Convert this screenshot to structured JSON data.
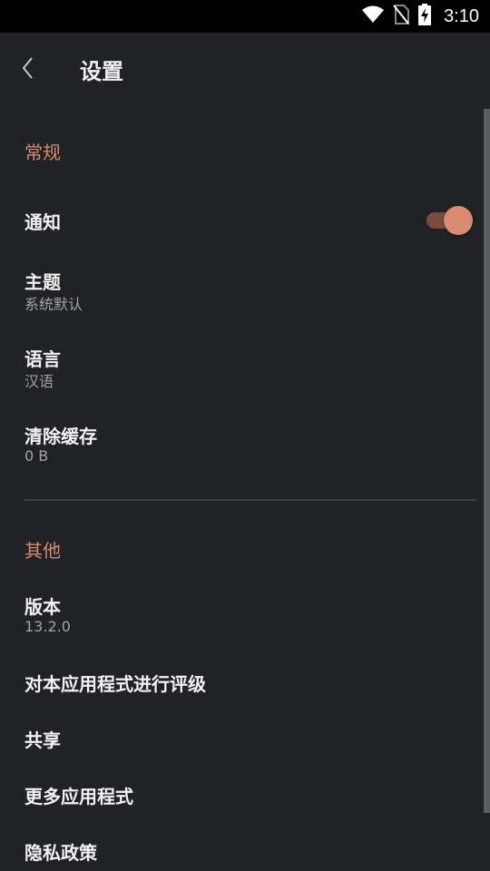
{
  "status_bar": {
    "time": "3:10",
    "icons": [
      "wifi-icon",
      "no-sim-icon",
      "battery-charging-icon"
    ]
  },
  "toolbar": {
    "back_icon": "chevron-left-icon",
    "title": "设置"
  },
  "sections": {
    "general": {
      "header": "常规",
      "notifications": {
        "title": "通知",
        "enabled": true
      },
      "theme": {
        "title": "主题",
        "value": "系统默认"
      },
      "language": {
        "title": "语言",
        "value": "汉语"
      },
      "clear_cache": {
        "title": "清除缓存",
        "value": "0 B"
      }
    },
    "other": {
      "header": "其他",
      "version": {
        "title": "版本",
        "value": "13.2.0"
      },
      "rate_app": {
        "title": "对本应用程式进行评级"
      },
      "share": {
        "title": "共享"
      },
      "more_apps": {
        "title": "更多应用程式"
      },
      "privacy_policy": {
        "title": "隐私政策"
      }
    }
  },
  "colors": {
    "background": "#212226",
    "accent": "#d98a72",
    "status_bar": "#000000",
    "text_primary": "#f2f2f2",
    "text_secondary": "#a4a4a8"
  }
}
